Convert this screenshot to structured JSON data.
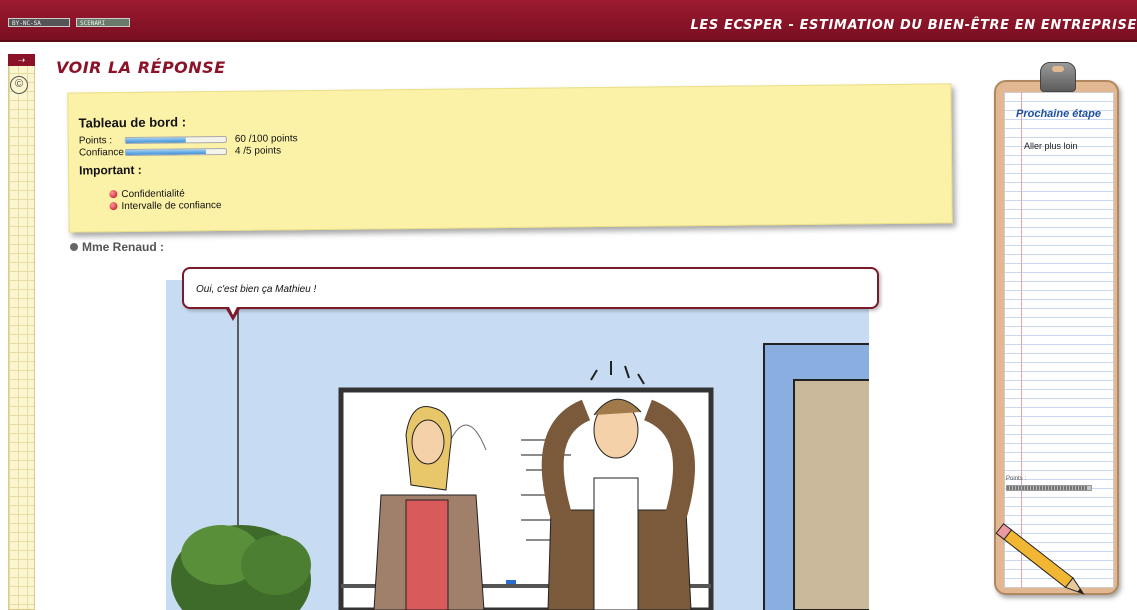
{
  "topbar": {
    "license_label": "BY-NC-SA",
    "brand_label": "SCENARI",
    "title": "LES ECSPER - ESTIMATION DU BIEN-ÊTRE EN ENTREPRISE"
  },
  "page": {
    "heading": "VOIR LA RÉPONSE"
  },
  "dashboard": {
    "title": "Tableau de bord :",
    "points": {
      "label": "Points :",
      "value_text": "60 /100 points",
      "fraction": 0.6
    },
    "confidence": {
      "label": "Confiance :",
      "value_text": "4 /5 points",
      "fraction": 0.8
    },
    "important_title": "Important :",
    "links": [
      "Confidentialité",
      "Intervalle de confiance"
    ]
  },
  "dialogue": {
    "speaker": "Mme Renaud :",
    "bubble_text": "Oui, c'est bien ça Mathieu !"
  },
  "clipboard": {
    "title": "Prochaine étape",
    "next_item": "Aller plus loin",
    "points_label": "Points :",
    "points_fraction": 0.95
  },
  "colors": {
    "brand": "#8c1228",
    "accent_blue": "#1f4fa0",
    "note_yellow": "#fbf2a8"
  }
}
